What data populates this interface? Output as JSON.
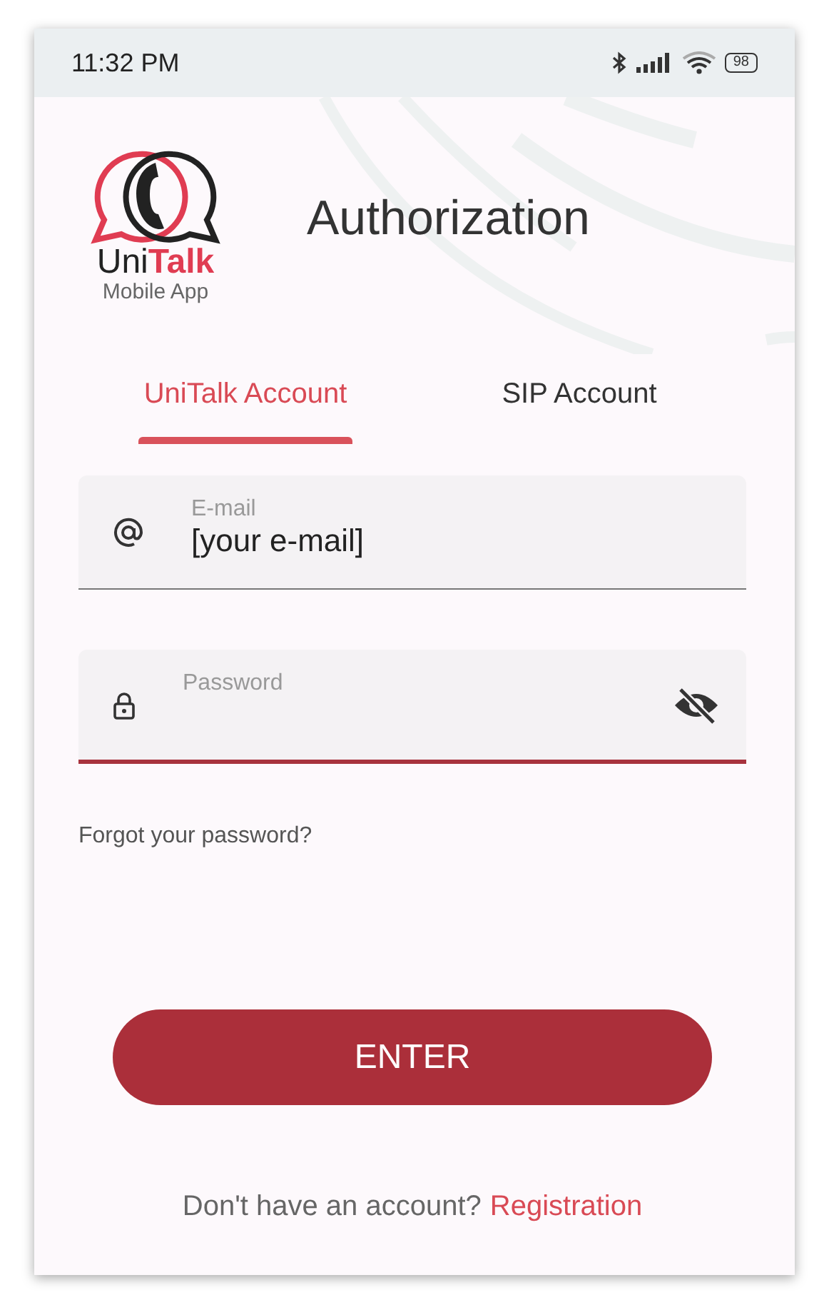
{
  "status_bar": {
    "time": "11:32 PM",
    "battery": "98"
  },
  "logo": {
    "wordmark": [
      "Uni",
      "Talk"
    ],
    "subtitle": "Mobile App"
  },
  "title": "Authorization",
  "tabs": [
    {
      "label": "UniTalk Account",
      "selected": true
    },
    {
      "label": "SIP Account",
      "selected": false
    }
  ],
  "fields": [
    {
      "kind": "email",
      "label": "E-mail",
      "value": "[your e-mail]",
      "focused": false
    },
    {
      "kind": "password",
      "label": "Password",
      "focused": true
    }
  ],
  "forgot_link": "Forgot your password?",
  "enter_button": "ENTER",
  "footer": {
    "text": "Don't have an account?",
    "link": "Registration"
  }
}
